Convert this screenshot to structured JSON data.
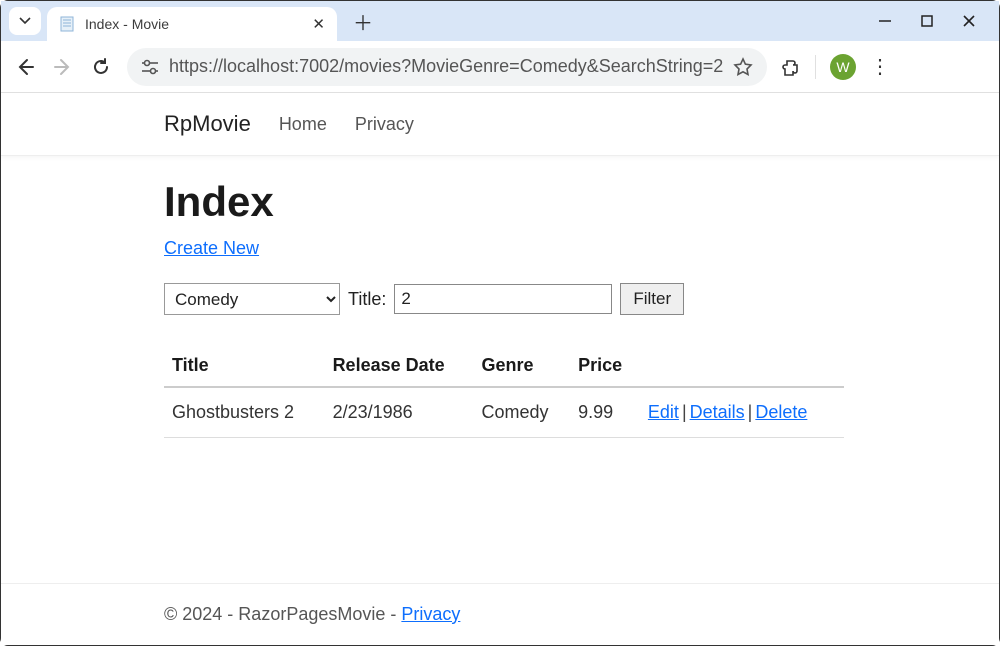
{
  "browser": {
    "tab_title": "Index - Movie",
    "url": "https://localhost:7002/movies?MovieGenre=Comedy&SearchString=2",
    "avatar_initial": "W"
  },
  "nav": {
    "brand": "RpMovie",
    "links": [
      "Home",
      "Privacy"
    ]
  },
  "page": {
    "title": "Index",
    "create_link": "Create New",
    "genre_selected": "Comedy",
    "title_label": "Title:",
    "title_value": "2",
    "filter_button": "Filter"
  },
  "table": {
    "headers": [
      "Title",
      "Release Date",
      "Genre",
      "Price",
      ""
    ],
    "rows": [
      {
        "title": "Ghostbusters 2",
        "release_date": "2/23/1986",
        "genre": "Comedy",
        "price": "9.99",
        "actions": {
          "edit": "Edit",
          "details": "Details",
          "delete": "Delete"
        }
      }
    ]
  },
  "footer": {
    "copyright": "© 2024 - RazorPagesMovie - ",
    "privacy_link": "Privacy"
  }
}
